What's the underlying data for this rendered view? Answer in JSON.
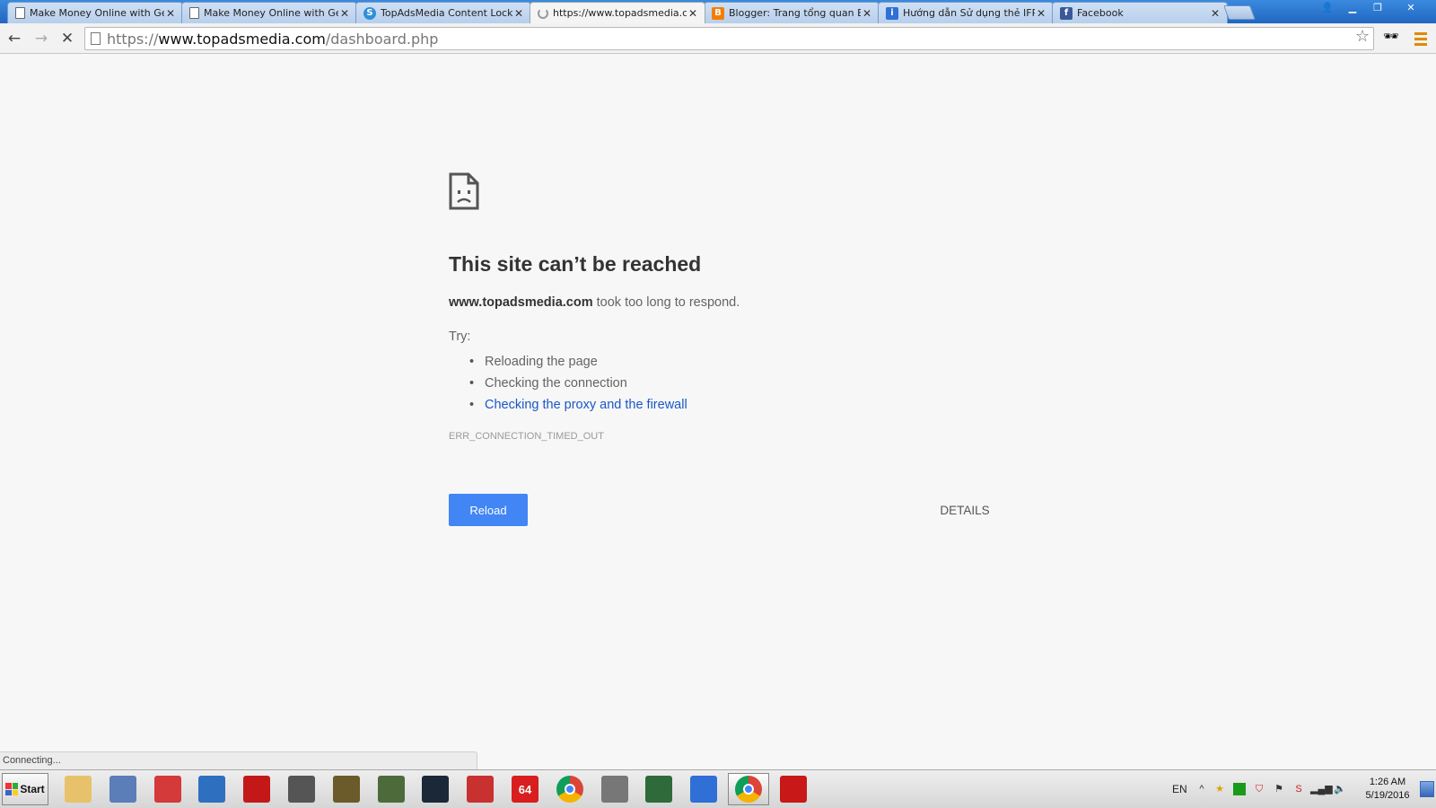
{
  "tabs": [
    {
      "title": "Make Money Online with Get",
      "favicon": "page-icon",
      "active": false
    },
    {
      "title": "Make Money Online with Get",
      "favicon": "page-icon",
      "active": false
    },
    {
      "title": "TopAdsMedia Content Lockin",
      "favicon": "topadsmedia-icon",
      "active": false
    },
    {
      "title": "https://www.topadsmedia.co",
      "favicon": "loading-spinner-icon",
      "active": true
    },
    {
      "title": "Blogger: Trang tổng quan Bl",
      "favicon": "blogger-icon",
      "active": false
    },
    {
      "title": "Hướng dẫn Sử dụng thẻ IFRA",
      "favicon": "ifr-icon",
      "active": false
    },
    {
      "title": "Facebook",
      "favicon": "facebook-icon",
      "active": false
    }
  ],
  "address_bar": {
    "scheme": "https://",
    "host": "www.topadsmedia.com",
    "path": "/dashboard.php"
  },
  "error_page": {
    "title": "This site can’t be reached",
    "host": "www.topadsmedia.com",
    "description": " took too long to respond.",
    "try_label": "Try:",
    "suggestions": [
      {
        "text": "Reloading the page",
        "link": false
      },
      {
        "text": "Checking the connection",
        "link": false
      },
      {
        "text": "Checking the proxy and the firewall",
        "link": true
      }
    ],
    "error_code": "ERR_CONNECTION_TIMED_OUT",
    "reload_label": "Reload",
    "details_label": "DETAILS"
  },
  "status_bubble": "Connecting...",
  "taskbar": {
    "start_label": "Start",
    "apps": [
      {
        "name": "file-explorer",
        "label": "",
        "color": "#e8c26a"
      },
      {
        "name": "keyboard-app",
        "label": "",
        "color": "#5b7db8"
      },
      {
        "name": "molecule-app",
        "label": "",
        "color": "#d43a3a"
      },
      {
        "name": "shield-app",
        "label": "",
        "color": "#2f6fc0"
      },
      {
        "name": "flash-app",
        "label": "",
        "color": "#c41818"
      },
      {
        "name": "computer-99-app",
        "label": "",
        "color": "#555555"
      },
      {
        "name": "game-app",
        "label": "",
        "color": "#6b5a2a"
      },
      {
        "name": "gta-v-app",
        "label": "",
        "color": "#4d6b3a"
      },
      {
        "name": "steam-app",
        "label": "",
        "color": "#1b2838"
      },
      {
        "name": "unikey-app",
        "label": "",
        "color": "#c93030"
      },
      {
        "name": "aida64-app",
        "label": "64",
        "color": "#d81e1e"
      },
      {
        "name": "chrome-app",
        "label": "",
        "color": "#3a9a44"
      },
      {
        "name": "tools-app",
        "label": "",
        "color": "#777777"
      },
      {
        "name": "monitor-app",
        "label": "",
        "color": "#2f6a3a"
      },
      {
        "name": "star-app",
        "label": "",
        "color": "#2f6fd6"
      },
      {
        "name": "chrome-active-app",
        "label": "",
        "color": "#3a9a44"
      },
      {
        "name": "dx-app",
        "label": "",
        "color": "#c81818"
      }
    ],
    "tray": {
      "language": "EN",
      "time": "1:26 AM",
      "date": "5/19/2016"
    }
  },
  "colors": {
    "tabstrip": "#1f67c0",
    "link": "#1a57c7",
    "reload_button": "#4285f4"
  }
}
